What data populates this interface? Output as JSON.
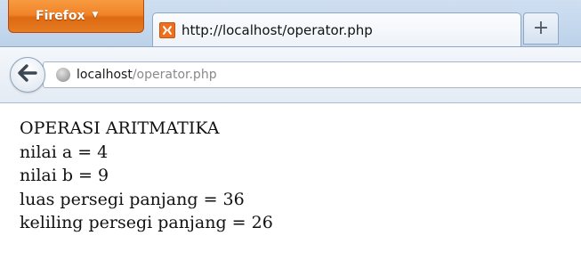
{
  "browser": {
    "menu_button_label": "Firefox",
    "menu_button_color": "#f1842a",
    "tab": {
      "title": "http://localhost/operator.php",
      "favicon": "xampp-icon"
    },
    "new_tab_label": "+",
    "back_icon": "back-arrow-icon",
    "site_icon": "globe-icon",
    "url_host": "localhost",
    "url_path": "/operator.php"
  },
  "page": {
    "heading": "OPERASI ARITMATIKA",
    "lines": [
      "nilai a = 4",
      "nilai b = 9",
      "luas persegi panjang = 36",
      "keliling persegi panjang = 26"
    ]
  }
}
